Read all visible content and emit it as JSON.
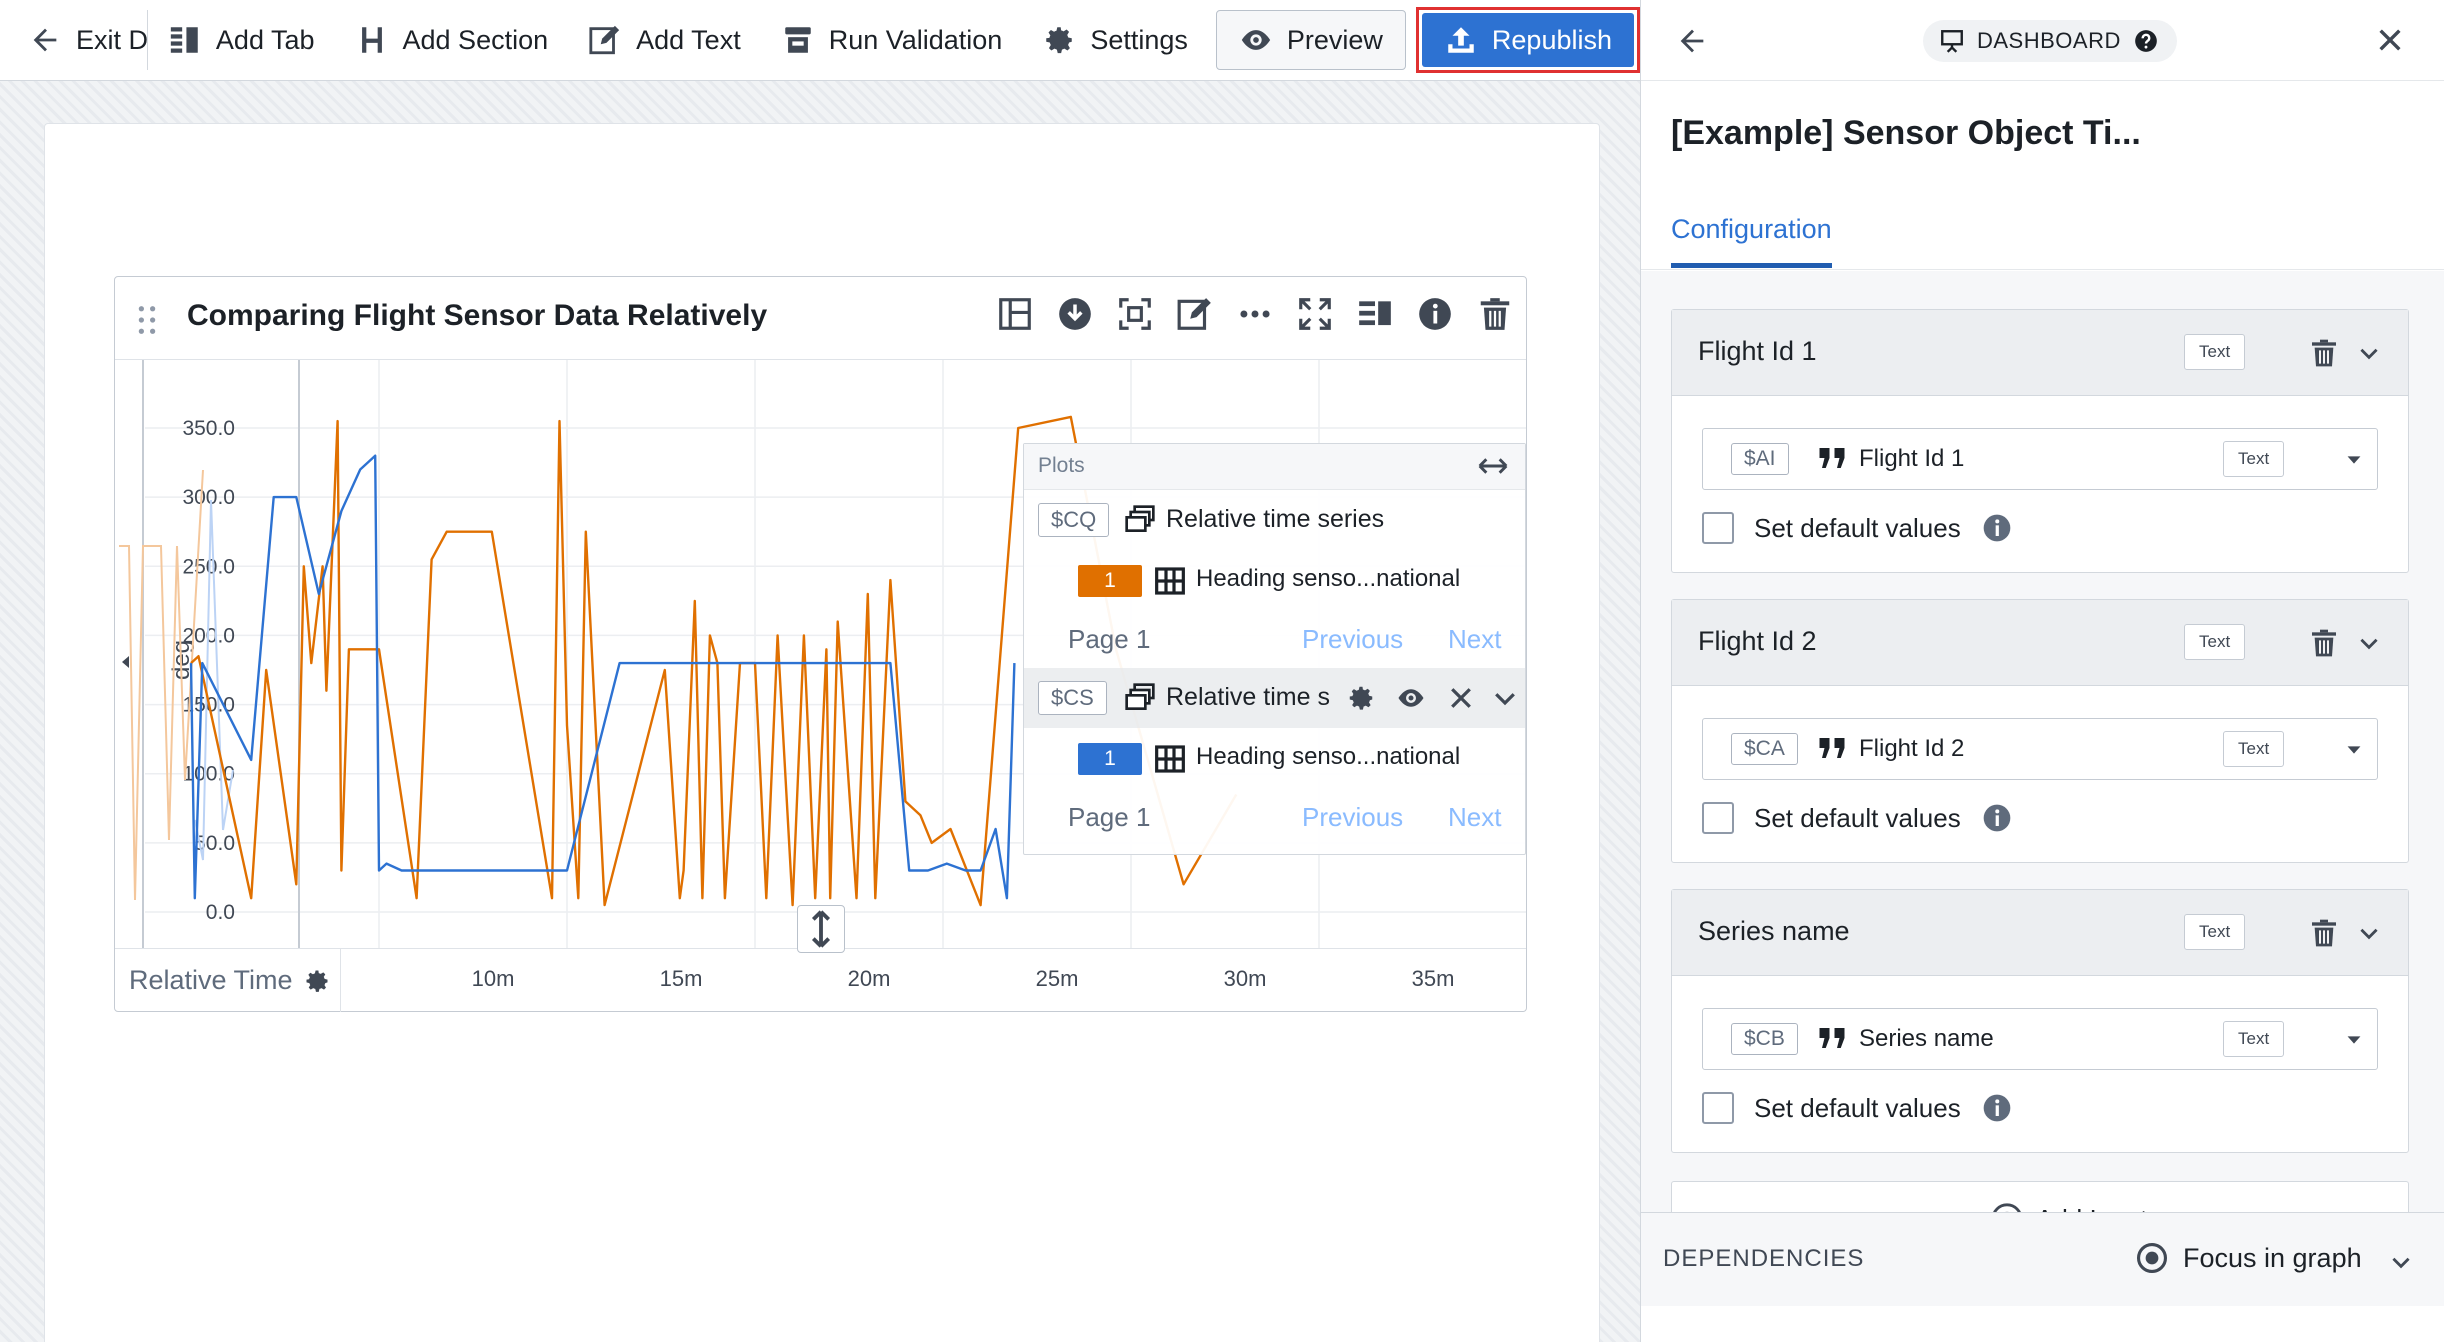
{
  "toolbar": {
    "exit_label": "Exit Dashboard",
    "add_tab": "Add Tab",
    "add_section": "Add Section",
    "add_text": "Add Text",
    "run_validation": "Run Validation",
    "settings": "Settings",
    "preview": "Preview",
    "republish": "Republish"
  },
  "widget": {
    "title": "Comparing Flight Sensor Data Relatively",
    "y_axis_label": "deg",
    "y_ticks": [
      "350.0",
      "300.0",
      "250.0",
      "200.0",
      "150.0",
      "100.0",
      "50.0",
      "0.0"
    ],
    "x_axis_label": "Relative Time",
    "x_ticks": [
      "10m",
      "15m",
      "20m",
      "25m",
      "30m",
      "35m"
    ]
  },
  "plots_panel": {
    "title": "Plots",
    "plots": [
      {
        "variable": "$CQ",
        "name": "Relative time series",
        "series_badge": "1",
        "series_color": "#e07000",
        "series_name": "Heading senso...national",
        "page_label": "Page 1",
        "previous": "Previous",
        "next": "Next"
      },
      {
        "variable": "$CS",
        "name": "Relative time s",
        "series_badge": "1",
        "series_color": "#2d72d2",
        "series_name": "Heading senso...national",
        "page_label": "Page 1",
        "previous": "Previous",
        "next": "Next"
      }
    ]
  },
  "chart_data": {
    "type": "line",
    "ylabel": "deg",
    "xlabel": "Relative Time",
    "ylim": [
      0,
      350
    ],
    "x_unit": "minutes",
    "x_tick_labels": [
      "10m",
      "15m",
      "20m",
      "25m",
      "30m",
      "35m"
    ],
    "series": [
      {
        "color": "#e07000",
        "x": [
          5.0,
          5.2,
          6.6,
          7.0,
          7.8,
          8.0,
          8.2,
          8.5,
          8.6,
          8.9,
          9.0,
          9.2,
          10.0,
          11.0,
          11.4,
          11.8,
          12.0,
          13.0,
          14.6,
          14.8,
          15.0,
          15.3,
          15.5,
          16.0,
          17.6,
          18.0,
          18.1,
          18.4,
          18.6,
          18.8,
          19.0,
          19.2,
          19.6,
          20.0,
          20.3,
          20.6,
          21.0,
          21.3,
          21.6,
          21.9,
          22.0,
          22.2,
          22.7,
          23.0,
          23.2,
          23.6,
          24.0,
          24.4,
          24.7,
          25.2,
          26.0,
          27.0,
          28.4,
          29.6,
          31.4,
          32.8
        ],
        "y": [
          180,
          185,
          10,
          175,
          20,
          250,
          180,
          250,
          160,
          355,
          30,
          190,
          190,
          10,
          255,
          275,
          275,
          275,
          10,
          355,
          135,
          10,
          275,
          5,
          175,
          10,
          30,
          225,
          10,
          200,
          180,
          10,
          180,
          180,
          10,
          200,
          5,
          200,
          10,
          190,
          10,
          210,
          10,
          230,
          10,
          240,
          80,
          70,
          50,
          60,
          5,
          350,
          360,
          190,
          20,
          85
        ]
      },
      {
        "color": "#2d72d2",
        "x": [
          5.0,
          5.1,
          5.3,
          6.6,
          7.2,
          7.8,
          8.4,
          9.0,
          9.5,
          9.9,
          10.0,
          10.2,
          10.6,
          15.0,
          16.4,
          21.0,
          23.6,
          24.1,
          24.3,
          24.6,
          25.1,
          25.6,
          26.0,
          26.4,
          26.7,
          26.9
        ],
        "y": [
          180,
          10,
          180,
          110,
          300,
          300,
          230,
          290,
          320,
          330,
          30,
          35,
          30,
          30,
          180,
          180,
          180,
          30,
          30,
          30,
          35,
          30,
          30,
          60,
          10,
          180
        ]
      }
    ]
  },
  "right_panel": {
    "badge": "DASHBOARD",
    "title": "[Example] Sensor Object Ti...",
    "tab": "Configuration",
    "inputs": [
      {
        "title": "Flight Id 1",
        "type": "Text",
        "variable": "$AI",
        "field_name": "Flight Id 1",
        "field_type": "Text",
        "checkbox_label": "Set default values"
      },
      {
        "title": "Flight Id 2",
        "type": "Text",
        "variable": "$CA",
        "field_name": "Flight Id 2",
        "field_type": "Text",
        "checkbox_label": "Set default values"
      },
      {
        "title": "Series name",
        "type": "Text",
        "variable": "$CB",
        "field_name": "Series name",
        "field_type": "Text",
        "checkbox_label": "Set default values"
      }
    ],
    "add_input": "Add Input",
    "dependencies": "DEPENDENCIES",
    "focus_in_graph": "Focus in graph"
  }
}
